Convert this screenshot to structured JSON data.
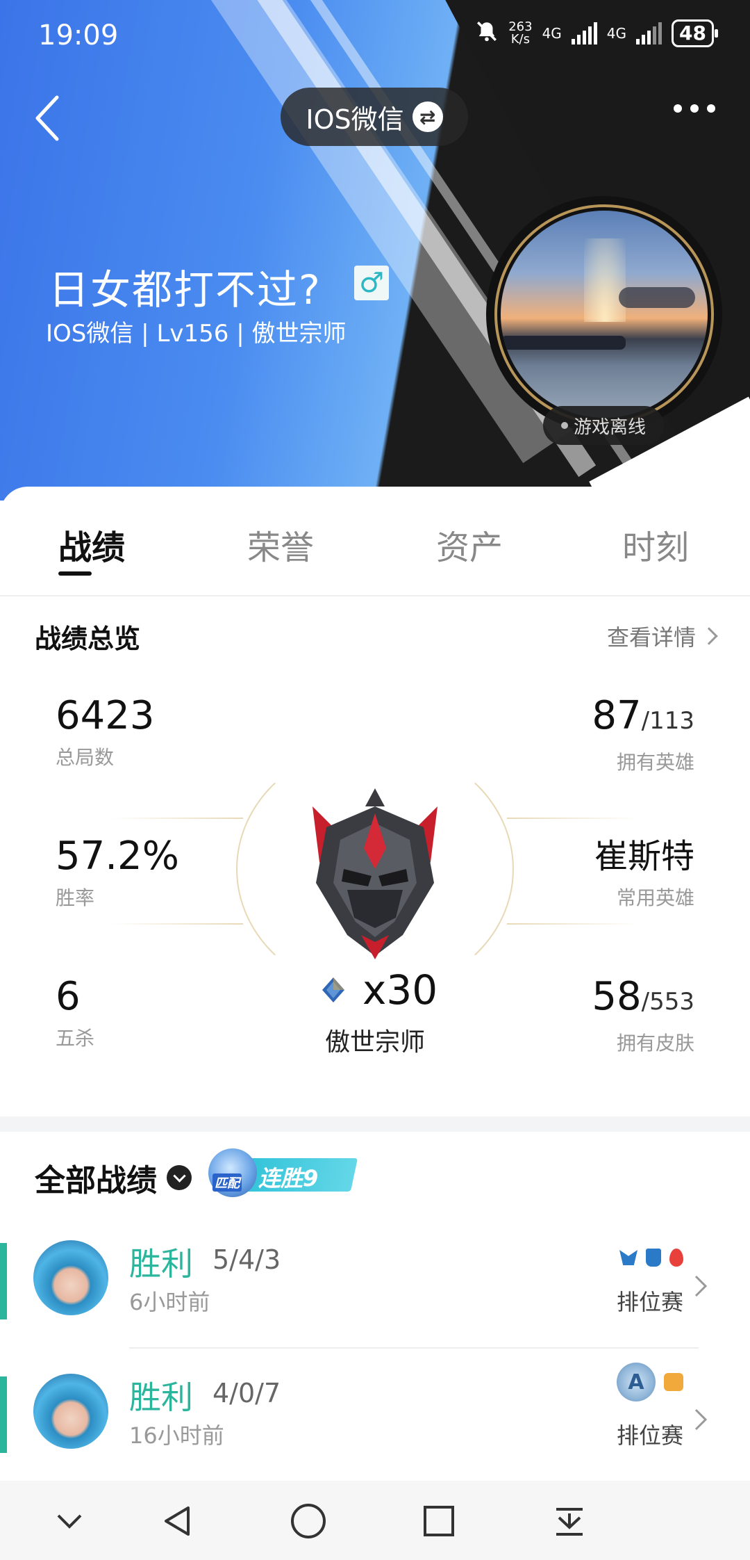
{
  "status_bar": {
    "time": "19:09",
    "net_speed": "263\nK/s",
    "net1": "4G",
    "net2": "4G",
    "battery": "48"
  },
  "header": {
    "platform_label": "IOS微信",
    "player_name": "日女都打不过?",
    "gender_symbol": "♂",
    "player_meta": "IOS微信 | Lv156 | 傲世宗师",
    "online_status": "游戏离线"
  },
  "tabs": [
    {
      "label": "战绩"
    },
    {
      "label": "荣誉"
    },
    {
      "label": "资产"
    },
    {
      "label": "时刻"
    }
  ],
  "overview": {
    "title": "战绩总览",
    "detail_link": "查看详情",
    "total_games": {
      "value": "6423",
      "label": "总局数"
    },
    "win_rate": {
      "value": "57.2%",
      "label": "胜率"
    },
    "pentakills": {
      "value": "6",
      "label": "五杀"
    },
    "heroes_owned": {
      "value": "87",
      "total": "/113",
      "label": "拥有英雄"
    },
    "common_hero": {
      "value": "崔斯特",
      "label": "常用英雄"
    },
    "skins_owned": {
      "value": "58",
      "total": "/553",
      "label": "拥有皮肤"
    },
    "rank_stars": "x30",
    "rank_name": "傲世宗师"
  },
  "matches": {
    "title": "全部战绩",
    "streak_badge": {
      "mascot_label": "匹配",
      "text": "连胜9"
    },
    "items": [
      {
        "result": "胜利",
        "kda": "5/4/3",
        "time": "6小时前",
        "mode": "排位赛"
      },
      {
        "result": "胜利",
        "kda": "4/0/7",
        "time": "16小时前",
        "mode": "排位赛"
      }
    ]
  },
  "colors": {
    "accent_win": "#2bb59c",
    "banner_blue": "#3b74e8",
    "banner_dark": "#1b1b1b",
    "streak_cyan": "#2ec1d7"
  }
}
